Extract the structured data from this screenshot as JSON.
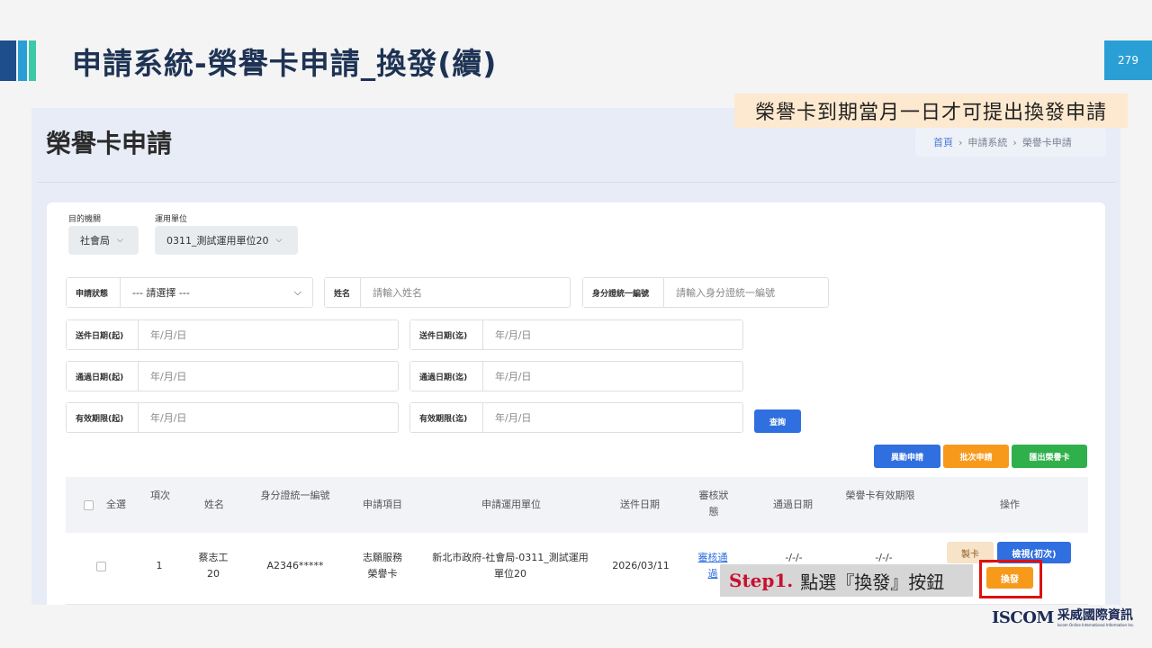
{
  "slide": {
    "title": "申請系統-榮譽卡申請_換發(續)",
    "page_number": "279",
    "note": "榮譽卡到期當月一日才可提出換發申請",
    "step_number": "Step1.",
    "step_text": "點選『換發』按鈕",
    "logo_en": "ISCOM",
    "logo_zh": "采威國際資訊",
    "logo_sub": "Iscom Online International Information Inc.",
    "colors": {
      "primary_blue": "#2f6fe0",
      "orange": "#f79a1c",
      "green": "#2fb04b",
      "highlight_red": "#d11111"
    }
  },
  "app": {
    "page_title": "榮譽卡申請",
    "breadcrumb": [
      "首頁",
      "申請系統",
      "榮譽卡申請"
    ],
    "filters": {
      "agency_label": "目的機關",
      "agency_value": "社會局",
      "unit_label": "運用單位",
      "unit_value": "0311_測試運用單位20"
    },
    "search": {
      "status_label": "申請狀態",
      "status_value": "--- 請選擇 ---",
      "name_label": "姓名",
      "name_placeholder": "請輸入姓名",
      "id_label": "身分證統一編號",
      "id_placeholder": "請輸入身分證統一編號",
      "send_start_label": "送件日期(起)",
      "send_end_label": "送件日期(迄)",
      "pass_start_label": "通過日期(起)",
      "pass_end_label": "通過日期(迄)",
      "valid_start_label": "有效期限(起)",
      "valid_end_label": "有效期限(迄)",
      "date_placeholder": "年/月/日",
      "query_button": "查詢"
    },
    "actions": {
      "change": "異動申請",
      "batch": "批次申請",
      "export": "匯出榮譽卡"
    },
    "table": {
      "headers": [
        "全選",
        "項次",
        "姓名",
        "身分證統一編號",
        "申請項目",
        "申請運用單位",
        "送件日期",
        "審核狀態",
        "通過日期",
        "榮譽卡有效期限",
        "操作"
      ],
      "rows": [
        {
          "index": "1",
          "name": "蔡志工20",
          "id": "A2346*****",
          "item": "志願服務榮譽卡",
          "unit": "新北市政府-社會局-0311_測試運用單位20",
          "send_date": "2026/03/11",
          "status": "審核通過",
          "pass_date": "-/-/-",
          "valid_date": "-/-/-",
          "btn_card": "製卡",
          "btn_view": "檢視(初次)",
          "btn_swap": "換發"
        }
      ]
    }
  }
}
